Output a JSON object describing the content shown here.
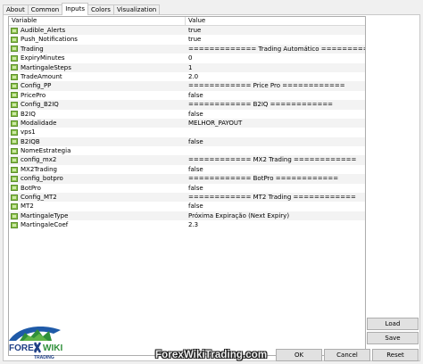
{
  "tabs": [
    "About",
    "Common",
    "Inputs",
    "Colors",
    "Visualization"
  ],
  "active_tab": "Inputs",
  "grid": {
    "header_variable": "Variable",
    "header_value": "Value",
    "rows": [
      {
        "variable": "Audible_Alerts",
        "value": "true"
      },
      {
        "variable": "Push_Notifications",
        "value": "true"
      },
      {
        "variable": "Trading",
        "value": "============= Trading Automático ============="
      },
      {
        "variable": "ExpiryMinutes",
        "value": "0"
      },
      {
        "variable": "MartingaleSteps",
        "value": "1"
      },
      {
        "variable": "TradeAmount",
        "value": "2.0"
      },
      {
        "variable": "Config_PP",
        "value": "============ Price Pro ============"
      },
      {
        "variable": "PricePro",
        "value": "false"
      },
      {
        "variable": "Config_B2IQ",
        "value": "============ B2IQ ============"
      },
      {
        "variable": "B2IQ",
        "value": "false"
      },
      {
        "variable": "Modalidade",
        "value": "MELHOR_PAYOUT"
      },
      {
        "variable": "vps1",
        "value": ""
      },
      {
        "variable": "B2IQB",
        "value": "false"
      },
      {
        "variable": "NomeEstrategia",
        "value": ""
      },
      {
        "variable": "config_mx2",
        "value": "============ MX2 Trading ============"
      },
      {
        "variable": "MX2Trading",
        "value": "false"
      },
      {
        "variable": "config_botpro",
        "value": "============ BotPro ============"
      },
      {
        "variable": "BotPro",
        "value": "false"
      },
      {
        "variable": "Config_MT2",
        "value": "============ MT2 Trading ============"
      },
      {
        "variable": "MT2",
        "value": "false"
      },
      {
        "variable": "MartingaleType",
        "value": "Próxima Expiração (Next Expiry)"
      },
      {
        "variable": "MartingaleCoef",
        "value": "2.3"
      }
    ]
  },
  "buttons": {
    "load": "Load",
    "save": "Save",
    "ok": "OK",
    "cancel": "Cancel",
    "reset": "Reset"
  },
  "logo": {
    "line1": "FOREX",
    "line2": "WIKI",
    "line3": "TRADING"
  },
  "watermark": "ForexWikiTrading.com",
  "colors": {
    "param_icon": "#8bc34a",
    "panel_bg": "#ffffff",
    "window_bg": "#f0f0f0"
  }
}
